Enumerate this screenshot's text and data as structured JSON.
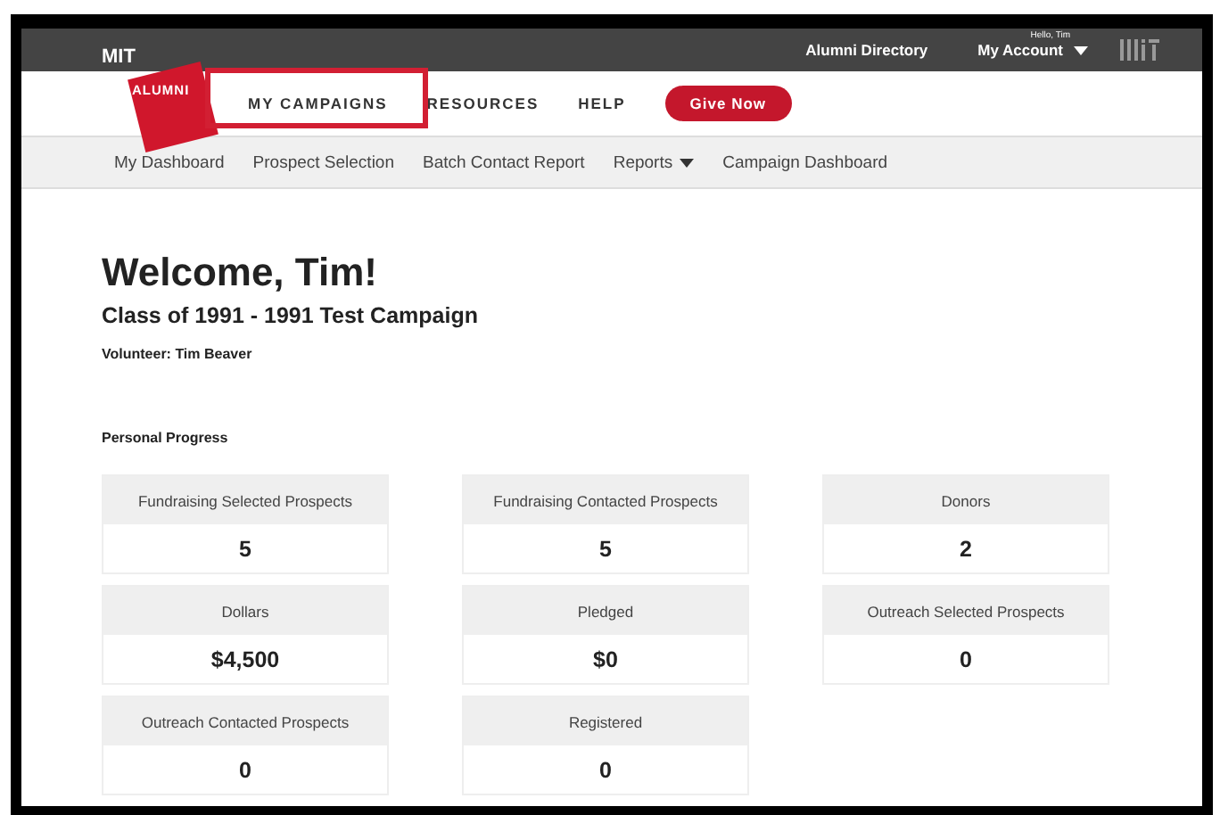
{
  "logo": {
    "top": "MIT",
    "badge": "ALUMNI"
  },
  "top_bar": {
    "greeting": "Hello, Tim",
    "links": [
      "Alumni Directory"
    ],
    "account": "My Account"
  },
  "nav": {
    "items": [
      {
        "label": "MY CAMPAIGNS",
        "highlighted": true
      },
      {
        "label": "RESOURCES",
        "highlighted": false
      },
      {
        "label": "HELP",
        "highlighted": false
      }
    ],
    "button": "Give Now"
  },
  "subnav": [
    {
      "label": "My Dashboard",
      "kind": "link"
    },
    {
      "label": "Prospect Selection",
      "kind": "link"
    },
    {
      "label": "Batch Contact Report",
      "kind": "link"
    },
    {
      "label": "Reports",
      "kind": "dropdown"
    },
    {
      "label": "Campaign Dashboard",
      "kind": "link"
    }
  ],
  "welcome": "Welcome, Tim!",
  "campaign": "Class of 1991 - 1991 Test Campaign",
  "volunteer": "Volunteer: Tim Beaver",
  "section_title": "Personal Progress",
  "stats": [
    {
      "label": "Fundraising Selected Prospects",
      "value": "5"
    },
    {
      "label": "Fundraising Contacted Prospects",
      "value": "5"
    },
    {
      "label": "Donors",
      "value": "2"
    },
    {
      "label": "Dollars",
      "value": "$4,500"
    },
    {
      "label": "Pledged",
      "value": "$0"
    },
    {
      "label": "Outreach Selected Prospects",
      "value": "0"
    },
    {
      "label": "Outreach Contacted Prospects",
      "value": "0"
    },
    {
      "label": "Registered",
      "value": "0"
    }
  ]
}
